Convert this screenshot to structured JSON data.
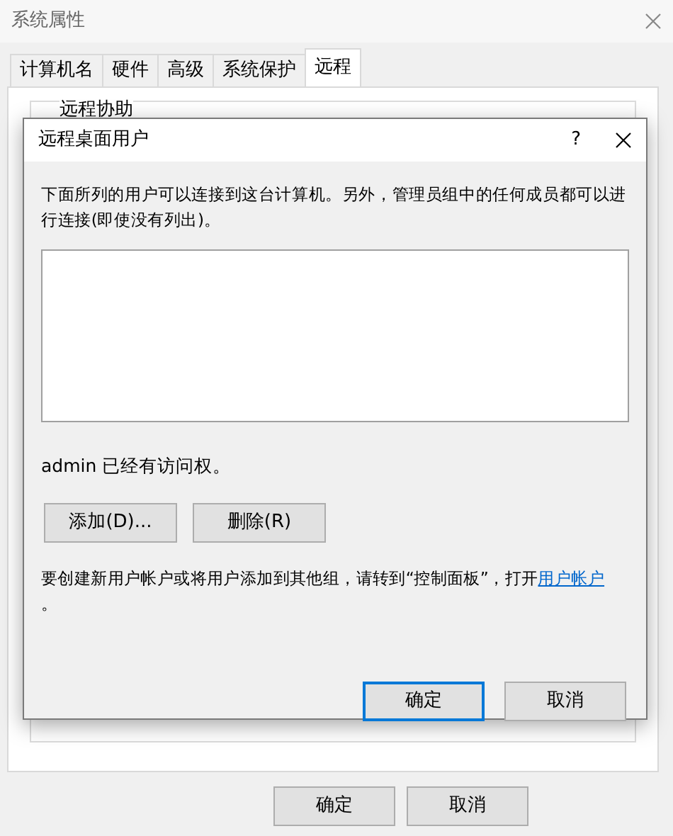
{
  "window": {
    "title": "系统属性"
  },
  "tabs": [
    {
      "label": "计算机名",
      "selected": false
    },
    {
      "label": "硬件",
      "selected": false
    },
    {
      "label": "高级",
      "selected": false
    },
    {
      "label": "系统保护",
      "selected": false
    },
    {
      "label": "远程",
      "selected": true
    }
  ],
  "panel": {
    "group_title": "远程协助"
  },
  "buttons": [
    {
      "label": "确定"
    },
    {
      "label": "取消"
    }
  ],
  "dialog": {
    "title": "远程桌面用户",
    "help": "?",
    "description": "下面所列的用户可以连接到这台计算机。另外，管理员组中的任何成员都可以进行连接(即使没有列出)。",
    "access_note": "admin 已经有访问权。",
    "actions": [
      "添加(D)...",
      "删除(R)"
    ],
    "info": {
      "text": "要创建新用户帐户或将用户添加到其他组，请转到“控制面板”，打开",
      "link": "用户帐户",
      "tail": "。"
    },
    "buttons": [
      {
        "label": "确定",
        "default": true
      },
      {
        "label": "取消",
        "default": false
      }
    ]
  }
}
